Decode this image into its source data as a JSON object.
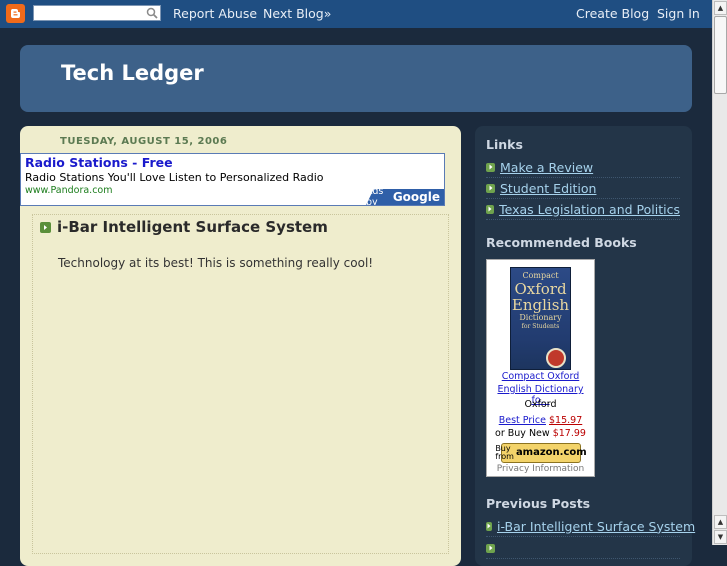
{
  "navbar": {
    "report_abuse": "Report Abuse",
    "next_blog": "Next Blog»",
    "create_blog": "Create Blog",
    "sign_in": "Sign In",
    "search_value": ""
  },
  "header": {
    "title": "Tech Ledger"
  },
  "main": {
    "date": "TUESDAY, AUGUST 15, 2006",
    "ad": {
      "title": "Radio Stations - Free",
      "text": "Radio Stations You'll Love Listen to Personalized Radio",
      "url": "www.Pandora.com",
      "badge_prefix": "Ads by",
      "badge_brand": "Google"
    },
    "post": {
      "title": "i-Bar Intelligent Surface System",
      "body": "Technology at its best! This is something really cool!"
    }
  },
  "sidebar": {
    "links_heading": "Links",
    "links": [
      {
        "label": "Make a Review"
      },
      {
        "label": "Student Edition"
      },
      {
        "label": "Texas Legislation and Politics"
      }
    ],
    "books_heading": "Recommended Books",
    "book": {
      "cover_line1": "Compact",
      "cover_line2": "Oxford",
      "cover_line3": "English",
      "cover_line4": "Dictionary",
      "cover_line5": "for Students",
      "title_line1": "Compact Oxford",
      "title_line2": "English Dictionary fo...",
      "author": "Oxford",
      "best_price_label": "Best Price",
      "best_price": "$15.97",
      "buy_new_label": "or Buy New",
      "buy_new_price": "$17.99",
      "buy_button_top": "Buy",
      "buy_button_bottom": "from",
      "buy_button_brand": "amazon.com",
      "privacy": "Privacy Information"
    },
    "previous_heading": "Previous Posts",
    "previous_posts": [
      {
        "label": "i-Bar Intelligent Surface System"
      }
    ]
  },
  "colors": {
    "page_bg": "#1b2a3d",
    "navbar_bg": "#1f4e82",
    "header_bg": "#3d6189",
    "main_bg": "#efedcd",
    "sidebar_bg": "#233548",
    "link": "#a6d2ec"
  }
}
